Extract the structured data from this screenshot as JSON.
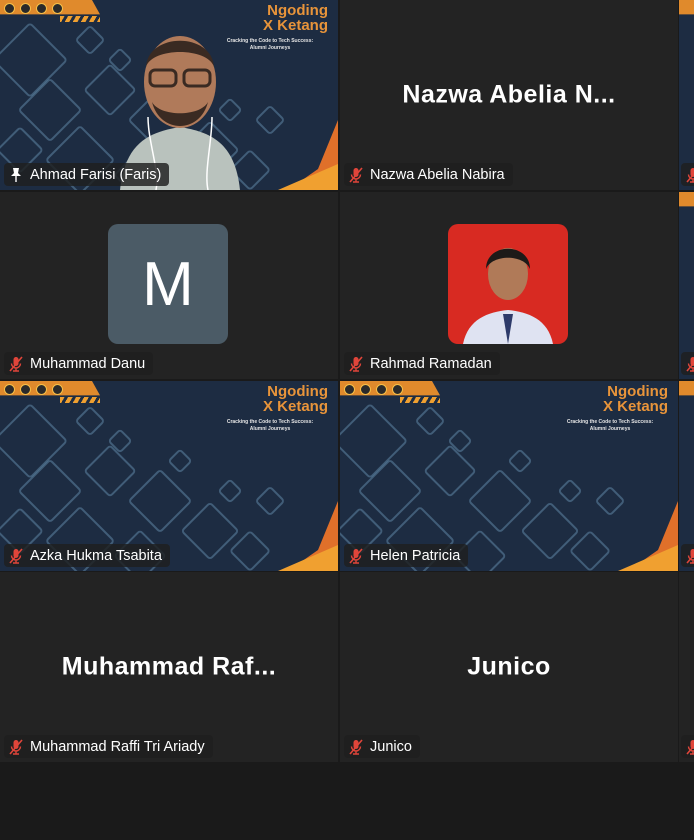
{
  "slide": {
    "title_line1": "Ngoding",
    "title_line2": "X Ketang",
    "subtitle_line1": "Cracking the Code to Tech Success:",
    "subtitle_line2": "Alumni Journeys"
  },
  "colors": {
    "active_border": "#23d18b",
    "muted_mic": "#e0453a",
    "slide_bg": "#1d2c42",
    "accent_orange": "#e8943a"
  },
  "tiles": [
    {
      "name": "Ahmad Farisi (Faris)",
      "type": "video",
      "icon": "pin-icon",
      "active": true
    },
    {
      "name": "Nazwa Abelia Nabira",
      "type": "name",
      "display": "Nazwa  Abelia  N...",
      "icon": "mic-muted-icon"
    },
    {
      "name": "Muhammad Danu",
      "type": "letter",
      "letter": "M",
      "icon": "mic-muted-icon"
    },
    {
      "name": "Rahmad Ramadan",
      "type": "photo",
      "icon": "mic-muted-icon"
    },
    {
      "name": "Azka Hukma Tsabita",
      "type": "slide",
      "icon": "mic-muted-icon"
    },
    {
      "name": "Helen Patricia",
      "type": "slide",
      "icon": "mic-muted-icon"
    },
    {
      "name": "Muhammad Raffi Tri Ariady",
      "type": "name",
      "display": "Muhammad  Raf...",
      "icon": "mic-muted-icon"
    },
    {
      "name": "Junico",
      "type": "name",
      "display": "Junico",
      "icon": "mic-muted-icon"
    }
  ]
}
